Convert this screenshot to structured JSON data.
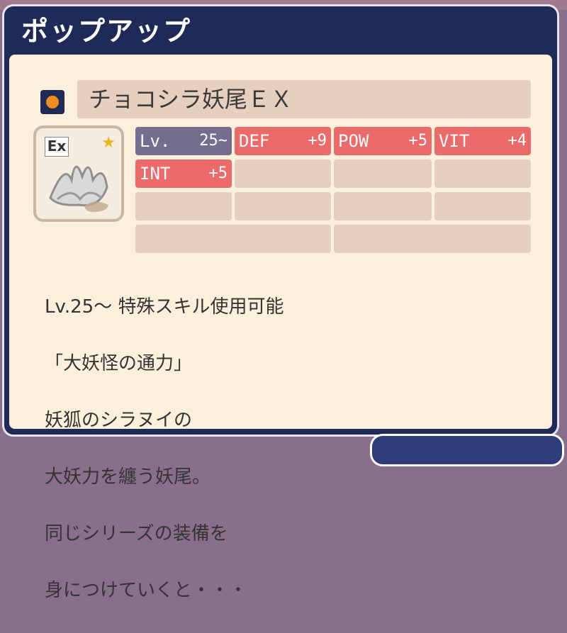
{
  "popup": {
    "title": "ポップアップ"
  },
  "item": {
    "name": "チョコシラ妖尾ＥＸ",
    "badge": "Ex",
    "rarity_color": "#f08d1e",
    "icon": "white-fox-tail-icon",
    "star_icon": "star-icon"
  },
  "stats": [
    {
      "label": "Lv.",
      "value": "25~",
      "style": "lv"
    },
    {
      "label": "DEF",
      "value": "+9",
      "style": "red"
    },
    {
      "label": "POW",
      "value": "+5",
      "style": "red"
    },
    {
      "label": "VIT",
      "value": "+4",
      "style": "red"
    },
    {
      "label": "INT",
      "value": "+5",
      "style": "red"
    }
  ],
  "description": [
    "Lv.25～ 特殊スキル使用可能",
    "「大妖怪の通力」",
    "妖狐のシラヌイの",
    "大妖力を纏う妖尾。",
    "同じシリーズの装備を",
    "身につけていくと・・・"
  ],
  "colors": {
    "title_bar": "#1f2a57",
    "panel": "#fbf0dc",
    "cell_empty": "#e7cfbf",
    "cell_stat": "#ea6b6a",
    "cell_level": "#756d8f"
  }
}
